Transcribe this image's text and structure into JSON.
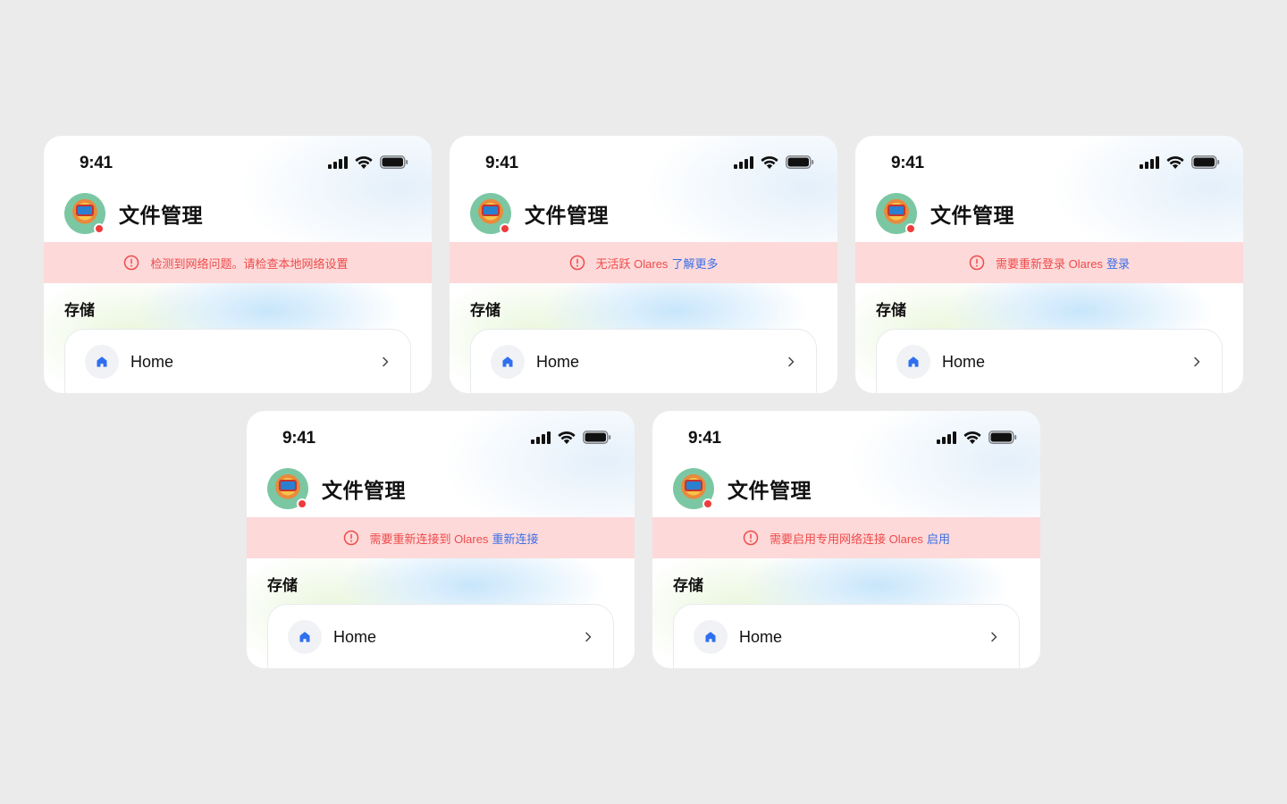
{
  "cards": [
    {
      "time": "9:41",
      "title": "文件管理",
      "banner": {
        "message": "检测到网络问题。请检查本地网络设置",
        "action": ""
      },
      "section": "存储",
      "item": "Home"
    },
    {
      "time": "9:41",
      "title": "文件管理",
      "banner": {
        "message": "无活跃 Olares",
        "action": "了解更多"
      },
      "section": "存储",
      "item": "Home"
    },
    {
      "time": "9:41",
      "title": "文件管理",
      "banner": {
        "message": "需要重新登录 Olares",
        "action": "登录"
      },
      "section": "存储",
      "item": "Home"
    },
    {
      "time": "9:41",
      "title": "文件管理",
      "banner": {
        "message": "需要重新连接到 Olares",
        "action": "重新连接"
      },
      "section": "存储",
      "item": "Home"
    },
    {
      "time": "9:41",
      "title": "文件管理",
      "banner": {
        "message": "需要启用专用网络连接 Olares",
        "action": "启用"
      },
      "section": "存储",
      "item": "Home"
    }
  ],
  "colors": {
    "background": "#ebebeb",
    "banner_bg": "#fdd9d9",
    "banner_text": "#ef4b4b",
    "link": "#3b6fe8",
    "home_icon": "#2f6ff0",
    "status_dot": "#ef3b3b"
  },
  "icons": {
    "signal": "cellular-signal-icon",
    "wifi": "wifi-icon",
    "battery": "battery-icon",
    "warning": "alert-circle-icon",
    "home": "home-icon",
    "chevron": "chevron-right-icon"
  }
}
